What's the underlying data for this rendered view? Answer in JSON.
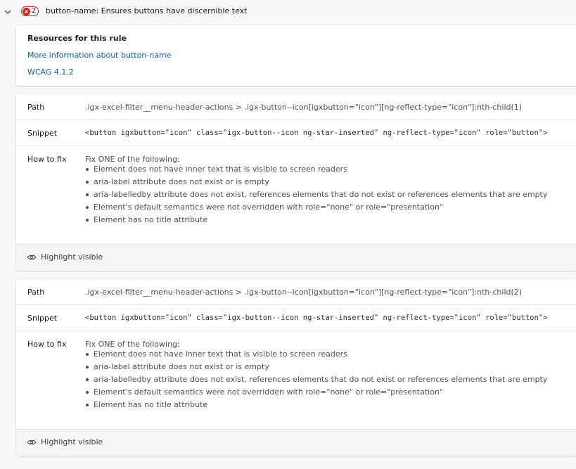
{
  "rule": {
    "name": "button-name",
    "description": "Ensures buttons have discernible text",
    "title": "button-name: Ensures buttons have discernible text",
    "failure_count": "2",
    "error_color": "#c42b1c"
  },
  "resources": {
    "title": "Resources for this rule",
    "links": [
      "More information about button-name",
      "WCAG 4.1.2"
    ],
    "link_color": "#0f5ec7"
  },
  "labels": {
    "path": "Path",
    "snippet": "Snippet",
    "how_to_fix": "How to fix",
    "highlight": "Highlight visible"
  },
  "instances": [
    {
      "path": ".igx-excel-filter__menu-header-actions > .igx-button--icon[igxbutton=\"icon\"][ng-reflect-type=\"icon\"]:nth-child(1)",
      "snippet": "<button igxbutton=\"icon\" class=\"igx-button--icon ng-star-inserted\" ng-reflect-type=\"icon\" role=\"button\">",
      "fix_intro": "Fix ONE of the following:",
      "fixes": [
        "Element does not have inner text that is visible to screen readers",
        "aria-label attribute does not exist or is empty",
        "aria-labelledby attribute does not exist, references elements that do not exist or references elements that are empty",
        "Element's default semantics were not overridden with role=\"none\" or role=\"presentation\"",
        "Element has no title attribute"
      ]
    },
    {
      "path": ".igx-excel-filter__menu-header-actions > .igx-button--icon[igxbutton=\"icon\"][ng-reflect-type=\"icon\"]:nth-child(2)",
      "snippet": "<button igxbutton=\"icon\" class=\"igx-button--icon ng-star-inserted\" ng-reflect-type=\"icon\" role=\"button\">",
      "fix_intro": "Fix ONE of the following:",
      "fixes": [
        "Element does not have inner text that is visible to screen readers",
        "aria-label attribute does not exist or is empty",
        "aria-labelledby attribute does not exist, references elements that do not exist or references elements that are empty",
        "Element's default semantics were not overridden with role=\"none\" or role=\"presentation\"",
        "Element has no title attribute"
      ]
    }
  ],
  "icons": {
    "expand": "chevron-down-icon",
    "error": "error-x-icon",
    "highlight": "eye-icon"
  }
}
